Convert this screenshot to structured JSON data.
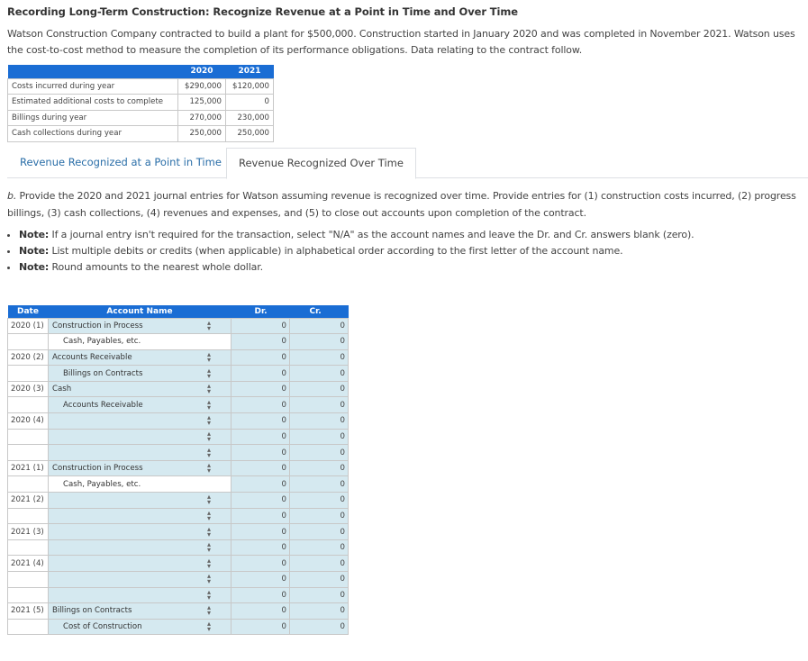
{
  "title": "Recording Long-Term Construction: Recognize Revenue at a Point in Time and Over Time",
  "intro": "Watson Construction Company contracted to build a plant for $500,000. Construction started in January 2020 and was completed in November 2021. Watson uses the cost-to-cost method to measure the completion of its performance obligations. Data relating to the contract follow.",
  "contract_table": {
    "headers": [
      "",
      "2020",
      "2021"
    ],
    "rows": [
      {
        "label": "Costs incurred during year",
        "y2020": "$290,000",
        "y2021": "$120,000"
      },
      {
        "label": "Estimated additional costs to complete",
        "y2020": "125,000",
        "y2021": "0"
      },
      {
        "label": "Billings during year",
        "y2020": "270,000",
        "y2021": "230,000"
      },
      {
        "label": "Cash collections during year",
        "y2020": "250,000",
        "y2021": "250,000"
      }
    ]
  },
  "tabs": [
    {
      "label": "Revenue Recognized at a Point in Time",
      "active": false
    },
    {
      "label": "Revenue Recognized Over Time",
      "active": true
    }
  ],
  "part_b": {
    "prefix": "b.",
    "text": " Provide the 2020 and 2021 journal entries for Watson assuming revenue is recognized over time. Provide entries for (1) construction costs incurred, (2) progress billings, (3) cash collections, (4) revenues and expenses, and (5) to close out accounts upon completion of the contract."
  },
  "notes": [
    {
      "label": "Note:",
      "text": " If a journal entry isn't required for the transaction, select \"N/A\" as the account  names and leave the Dr. and Cr. answers blank (zero)."
    },
    {
      "label": "Note:",
      "text": " List multiple debits or credits (when applicable) in alphabetical order according to the first letter of the account name."
    },
    {
      "label": "Note:",
      "text": " Round amounts to the nearest whole dollar."
    }
  ],
  "journal": {
    "headers": {
      "date": "Date",
      "account": "Account Name",
      "dr": "Dr.",
      "cr": "Cr."
    },
    "rows": [
      {
        "date": "2020 (1)",
        "account": "Construction in Process",
        "indent": false,
        "select": true,
        "dr": "0",
        "cr": "0"
      },
      {
        "date": "",
        "account": "Cash, Payables, etc.",
        "indent": true,
        "select": false,
        "dr": "0",
        "cr": "0"
      },
      {
        "date": "2020 (2)",
        "account": "Accounts Receivable",
        "indent": false,
        "select": true,
        "dr": "0",
        "cr": "0"
      },
      {
        "date": "",
        "account": "Billings on Contracts",
        "indent": true,
        "select": true,
        "dr": "0",
        "cr": "0"
      },
      {
        "date": "2020 (3)",
        "account": "Cash",
        "indent": false,
        "select": true,
        "dr": "0",
        "cr": "0"
      },
      {
        "date": "",
        "account": "Accounts Receivable",
        "indent": true,
        "select": true,
        "dr": "0",
        "cr": "0"
      },
      {
        "date": "2020 (4)",
        "account": "",
        "indent": false,
        "select": true,
        "dr": "0",
        "cr": "0"
      },
      {
        "date": "",
        "account": "",
        "indent": false,
        "select": true,
        "dr": "0",
        "cr": "0"
      },
      {
        "date": "",
        "account": "",
        "indent": false,
        "select": true,
        "dr": "0",
        "cr": "0"
      },
      {
        "date": "2021 (1)",
        "account": "Construction in Process",
        "indent": false,
        "select": true,
        "dr": "0",
        "cr": "0"
      },
      {
        "date": "",
        "account": "Cash, Payables, etc.",
        "indent": true,
        "select": false,
        "dr": "0",
        "cr": "0"
      },
      {
        "date": "2021 (2)",
        "account": "",
        "indent": false,
        "select": true,
        "dr": "0",
        "cr": "0"
      },
      {
        "date": "",
        "account": "",
        "indent": false,
        "select": true,
        "dr": "0",
        "cr": "0"
      },
      {
        "date": "2021 (3)",
        "account": "",
        "indent": false,
        "select": true,
        "dr": "0",
        "cr": "0"
      },
      {
        "date": "",
        "account": "",
        "indent": false,
        "select": true,
        "dr": "0",
        "cr": "0"
      },
      {
        "date": "2021 (4)",
        "account": "",
        "indent": false,
        "select": true,
        "dr": "0",
        "cr": "0"
      },
      {
        "date": "",
        "account": "",
        "indent": false,
        "select": true,
        "dr": "0",
        "cr": "0"
      },
      {
        "date": "",
        "account": "",
        "indent": false,
        "select": true,
        "dr": "0",
        "cr": "0"
      },
      {
        "date": "2021 (5)",
        "account": "Billings on Contracts",
        "indent": false,
        "select": true,
        "dr": "0",
        "cr": "0"
      },
      {
        "date": "",
        "account": "Cost of Construction",
        "indent": true,
        "select": true,
        "dr": "0",
        "cr": "0"
      }
    ]
  },
  "icons": {
    "select_arrows": "⇕"
  },
  "colors": {
    "header_blue": "#1a6dd4",
    "input_bg": "#d5e9f0",
    "tab_link": "#2a6ea8"
  }
}
